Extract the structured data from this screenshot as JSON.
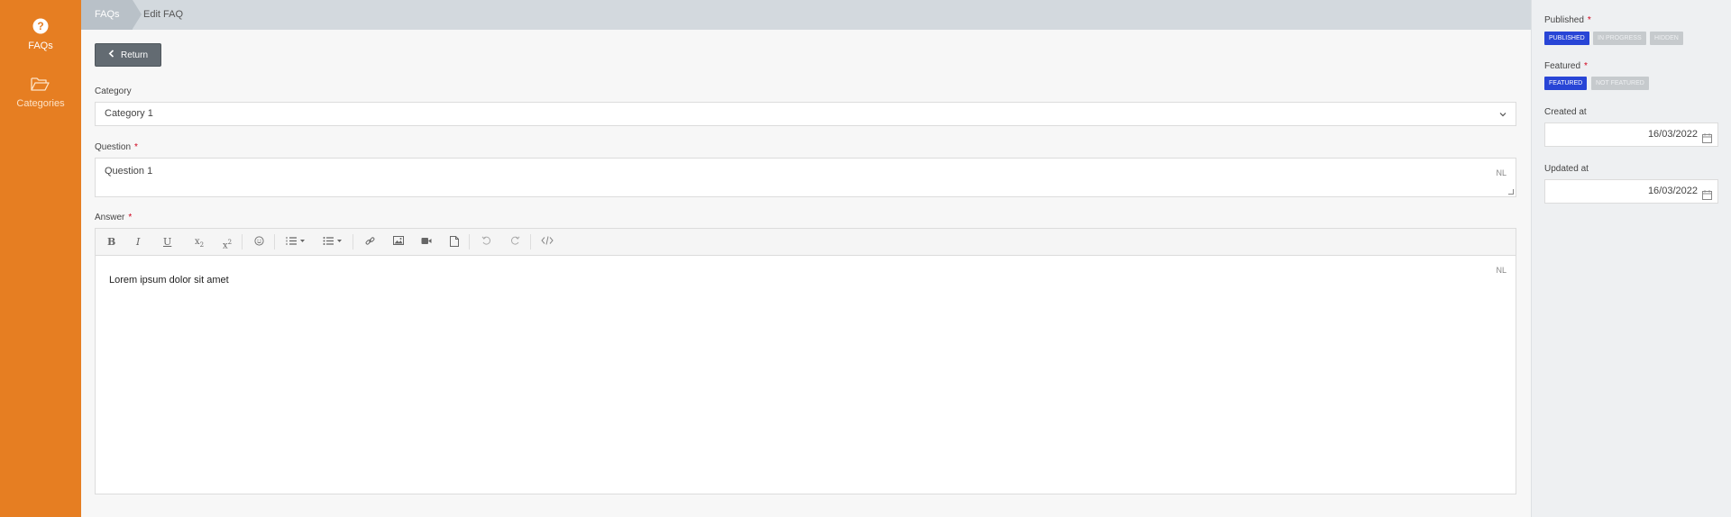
{
  "sidebar": {
    "items": [
      {
        "label": "FAQs",
        "icon": "question-circle-icon"
      },
      {
        "label": "Categories",
        "icon": "folder-open-icon"
      }
    ]
  },
  "breadcrumb": {
    "first": "FAQs",
    "second": "Edit FAQ"
  },
  "return_label": "Return",
  "form": {
    "category_label": "Category",
    "category_value": "Category 1",
    "question_label": "Question",
    "question_value": "Question 1",
    "question_lang": "NL",
    "answer_label": "Answer",
    "answer_value": "Lorem ipsum dolor sit amet",
    "answer_lang": "NL",
    "required_mark": "*"
  },
  "toolbar_items": [
    "bold-icon",
    "italic-icon",
    "underline-icon",
    "subscript-icon",
    "superscript-icon",
    "emoji-icon",
    "ordered-list-icon",
    "unordered-list-icon",
    "link-icon",
    "image-icon",
    "video-icon",
    "file-icon",
    "undo-icon",
    "redo-icon",
    "code-view-icon"
  ],
  "right_panel": {
    "published_label": "Published",
    "published_options": [
      "PUBLISHED",
      "IN PROGRESS",
      "HIDDEN"
    ],
    "published_selected": "PUBLISHED",
    "featured_label": "Featured",
    "featured_options": [
      "FEATURED",
      "NOT FEATURED"
    ],
    "featured_selected": "FEATURED",
    "created_label": "Created at",
    "created_value": "16/03/2022",
    "updated_label": "Updated at",
    "updated_value": "16/03/2022"
  },
  "colors": {
    "sidebar": "#e67e22",
    "accent": "#2845d6"
  }
}
